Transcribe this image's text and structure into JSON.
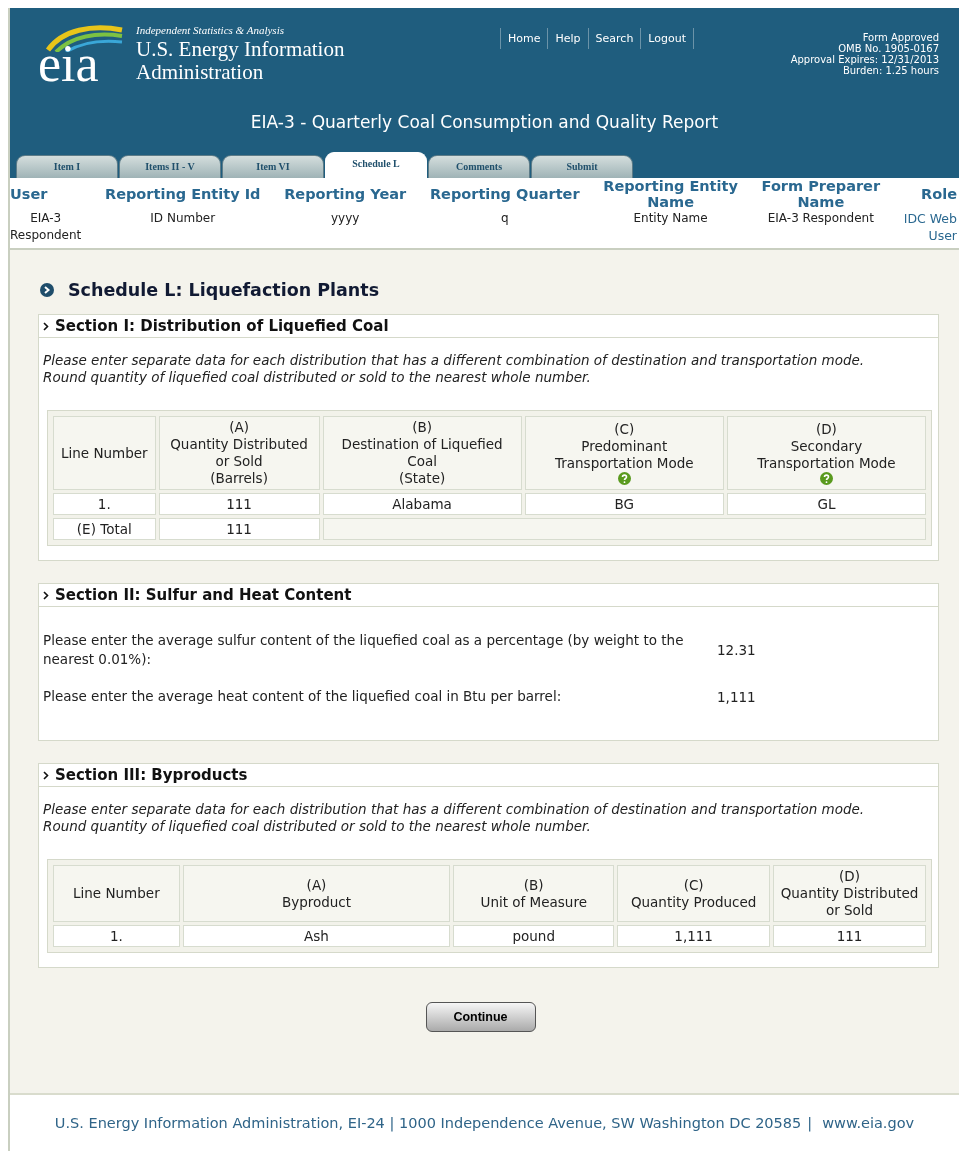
{
  "header": {
    "tagline": "Independent Statistics & Analysis",
    "logo_text": "eia",
    "agency": "U.S. Energy Information\nAdministration",
    "nav": [
      "Home",
      "Help",
      "Search",
      "Logout"
    ],
    "form_info": [
      "Form Approved",
      "OMB No. 1905-0167",
      "Approval Expires: 12/31/2013",
      "Burden: 1.25 hours"
    ],
    "title": "EIA-3 - Quarterly Coal Consumption and Quality Report"
  },
  "tabs": [
    {
      "label": "Item I",
      "selected": false
    },
    {
      "label": "Items II - V",
      "selected": false
    },
    {
      "label": "Item VI",
      "selected": false
    },
    {
      "label": "Schedule L",
      "selected": true
    },
    {
      "label": "Comments",
      "selected": false
    },
    {
      "label": "Submit",
      "selected": false
    }
  ],
  "info_columns": [
    {
      "heading": "User",
      "value": "EIA-3\nRespondent",
      "kind": "text"
    },
    {
      "heading": "Reporting Entity Id",
      "value": "ID Number",
      "kind": "text"
    },
    {
      "heading": "Reporting Year",
      "value": "yyyy",
      "kind": "text"
    },
    {
      "heading": "Reporting Quarter",
      "value": "q",
      "kind": "text"
    },
    {
      "heading": "Reporting Entity\nName",
      "value": "Entity Name",
      "kind": "text"
    },
    {
      "heading": "Form Preparer\nName",
      "value": "EIA-3 Respondent",
      "kind": "text"
    },
    {
      "heading": "Role",
      "value": "IDC Web\nUser",
      "kind": "link"
    }
  ],
  "page_title": "Schedule L: Liquefaction Plants",
  "section_1": {
    "title": "Section I: Distribution of Liquefied Coal",
    "instructions": "Please enter separate data for each distribution that has a different combination of destination and transportation mode.\nRound quantity of liquefied coal distributed or sold to the nearest whole number.",
    "columns": [
      {
        "label": "Line Number",
        "help": false
      },
      {
        "label": "(A)\nQuantity Distributed\nor Sold\n(Barrels)",
        "help": false
      },
      {
        "label": "(B)\nDestination of Liquefied\nCoal\n(State)",
        "help": false
      },
      {
        "label": "(C)\nPredominant\nTransportation Mode",
        "help": true
      },
      {
        "label": "(D)\nSecondary\nTransportation Mode",
        "help": true
      }
    ],
    "rows": [
      [
        "1.",
        "111",
        "Alabama",
        "BG",
        "GL"
      ]
    ],
    "total": {
      "label": "(E) Total",
      "value": "111"
    }
  },
  "section_2": {
    "title": "Section II: Sulfur and Heat Content",
    "fields": [
      {
        "label": "Please enter the average sulfur content of the liquefied coal as a percentage (by weight to the nearest 0.01%):",
        "value": "12.31"
      },
      {
        "label": "Please enter the average heat content of the liquefied coal in Btu per barrel:",
        "value": "1,111"
      }
    ]
  },
  "section_3": {
    "title": "Section III: Byproducts",
    "instructions": "Please enter separate data for each distribution that has a different combination of destination and transportation mode.\nRound quantity of liquefied coal distributed or sold to the nearest whole number.",
    "columns": [
      {
        "label": "Line Number",
        "help": false
      },
      {
        "label": "(A)\nByproduct",
        "help": false
      },
      {
        "label": "(B)\nUnit of Measure",
        "help": false
      },
      {
        "label": "(C)\nQuantity Produced",
        "help": false
      },
      {
        "label": "(D)\nQuantity Distributed\nor Sold",
        "help": false
      }
    ],
    "rows": [
      [
        "1.",
        "Ash",
        "pound",
        "1,111",
        "111"
      ]
    ]
  },
  "continue_button": "Continue",
  "footer": {
    "address": "U.S. Energy Information Administration, EI-24 | 1000 Independence Avenue, SW Washington DC 20585",
    "separator": "|",
    "link": "www.eia.gov"
  }
}
